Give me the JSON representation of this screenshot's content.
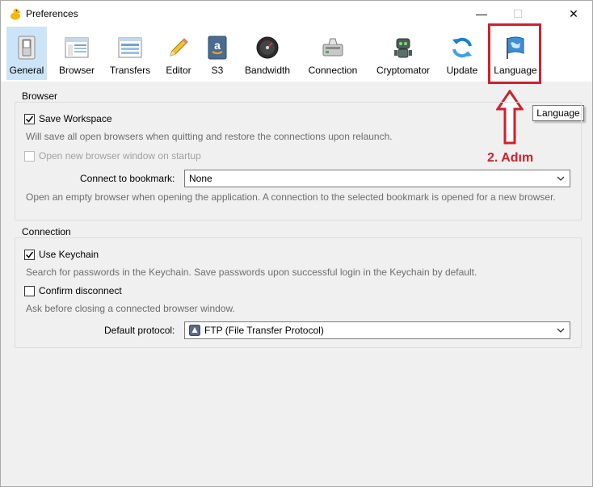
{
  "window": {
    "title": "Preferences"
  },
  "window_controls": {
    "minimize": "—",
    "maximize": "☐",
    "close": "✕"
  },
  "toolbar": {
    "items": [
      {
        "label": "General",
        "icon": "general-switch-icon",
        "selected": true
      },
      {
        "label": "Browser",
        "icon": "browser-window-icon"
      },
      {
        "label": "Transfers",
        "icon": "transfers-list-icon"
      },
      {
        "label": "Editor",
        "icon": "pencil-icon"
      },
      {
        "label": "S3",
        "icon": "amazon-s3-icon"
      },
      {
        "label": "Bandwidth",
        "icon": "speedometer-icon"
      },
      {
        "label": "Connection",
        "icon": "network-connection-icon"
      },
      {
        "label": "Cryptomator",
        "icon": "cryptomator-robot-icon"
      },
      {
        "label": "Update",
        "icon": "update-refresh-icon"
      },
      {
        "label": "Language",
        "icon": "language-flag-icon"
      }
    ]
  },
  "tooltip": {
    "text": "Language"
  },
  "annotation": {
    "step_label": "2. Adım",
    "color": "#d0202e"
  },
  "browser_group": {
    "title": "Browser",
    "save_workspace": {
      "label": "Save Workspace",
      "checked": true
    },
    "save_workspace_desc": "Will save all open browsers when quitting and restore the connections upon relaunch.",
    "open_new_window": {
      "label": "Open new browser window on startup",
      "checked": false,
      "disabled": true
    },
    "connect_bookmark_label": "Connect to bookmark:",
    "connect_bookmark_value": "None",
    "connect_bookmark_desc": "Open an empty browser when opening the application. A connection to the selected bookmark is opened for a new browser."
  },
  "connection_group": {
    "title": "Connection",
    "use_keychain": {
      "label": "Use Keychain",
      "checked": true
    },
    "use_keychain_desc": "Search for passwords in the Keychain. Save passwords upon successful login in the Keychain by default.",
    "confirm_disconnect": {
      "label": "Confirm disconnect",
      "checked": false
    },
    "confirm_disconnect_desc": "Ask before closing a connected browser window.",
    "default_protocol_label": "Default protocol:",
    "default_protocol_value": "FTP (File Transfer Protocol)"
  }
}
